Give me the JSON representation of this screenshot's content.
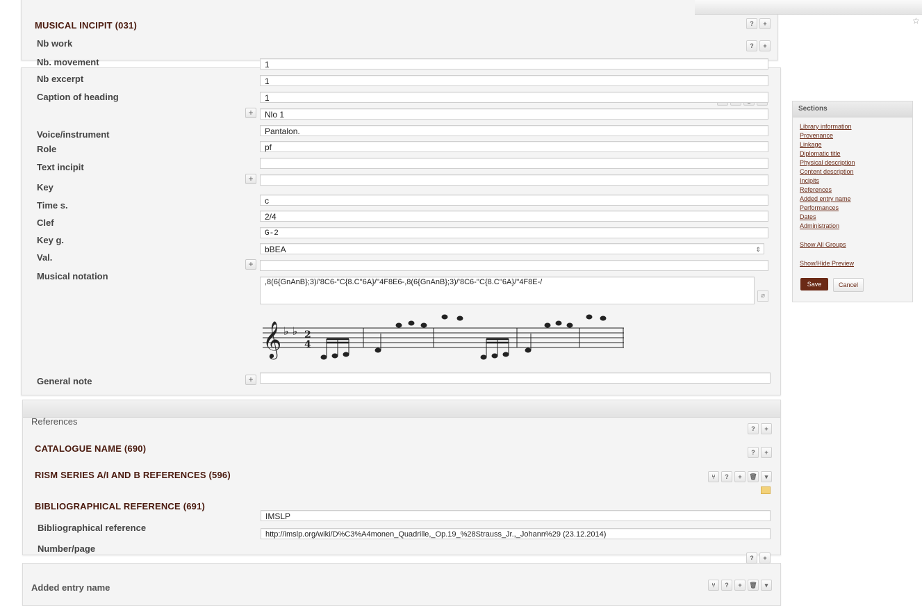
{
  "incipit": {
    "title": "MUSICAL INCIPIT (031)",
    "labels": {
      "nb_work": "Nb work",
      "nb_movement": "Nb. movement",
      "nb_excerpt": "Nb excerpt",
      "caption": "Caption of heading",
      "voice": "Voice/instrument",
      "role": "Role",
      "text_incipit": "Text incipit",
      "key": "Key",
      "time": "Time s.",
      "clef": "Clef",
      "keyg": "Key g.",
      "val": "Val.",
      "notation": "Musical notation",
      "general_note": "General note"
    },
    "values": {
      "nb_work": "1",
      "nb_movement": "1",
      "nb_excerpt": "1",
      "caption": "Nlo 1",
      "voice": "Pantalon.",
      "role": "pf",
      "text_incipit": "",
      "key": "",
      "key_value": "c",
      "time": "2/4",
      "clef": "G-2",
      "keyg": "bBEA",
      "val": "",
      "notation": ",8(6{GnAnB};3)/'8C6-''C{8.C''6A}/''4F8E6-,8(6{GnAnB};3)/'8C6-''C{8.C''6A}/''4F8E-/",
      "general_note": ""
    }
  },
  "references": {
    "section_title": "References",
    "catalogue_title": "CATALOGUE NAME (690)",
    "rism_title": "RISM SERIES A/I AND B REFERENCES (596)",
    "biblio_title": "BIBLIOGRAPHICAL REFERENCE (691)",
    "biblio_label": "Bibliographical reference",
    "number_label": "Number/page",
    "biblio_value": "IMSLP",
    "number_value": "http://imslp.org/wiki/D%C3%A4monen_Quadrille,_Op.19_%28Strauss_Jr.,_Johann%29 (23.12.2014)"
  },
  "added_entry": {
    "title": "Added entry name"
  },
  "sidebar": {
    "title": "Sections",
    "links": [
      "Library information",
      "Provenance",
      "Linkage",
      "Diplomatic title",
      "Physical description",
      "Content description",
      "Incipits",
      "References",
      "Added entry name",
      "Performances",
      "Dates",
      "Administration"
    ],
    "show_all": "Show All Groups",
    "show_hide": "Show/Hide Preview",
    "save": "Save",
    "cancel": "Cancel"
  },
  "icons": {
    "help": "?",
    "add": "+",
    "delete": "🗑",
    "menu": "▾"
  },
  "colors": {
    "accent": "#6b2a16",
    "tag_title": "#4a1a0e"
  }
}
